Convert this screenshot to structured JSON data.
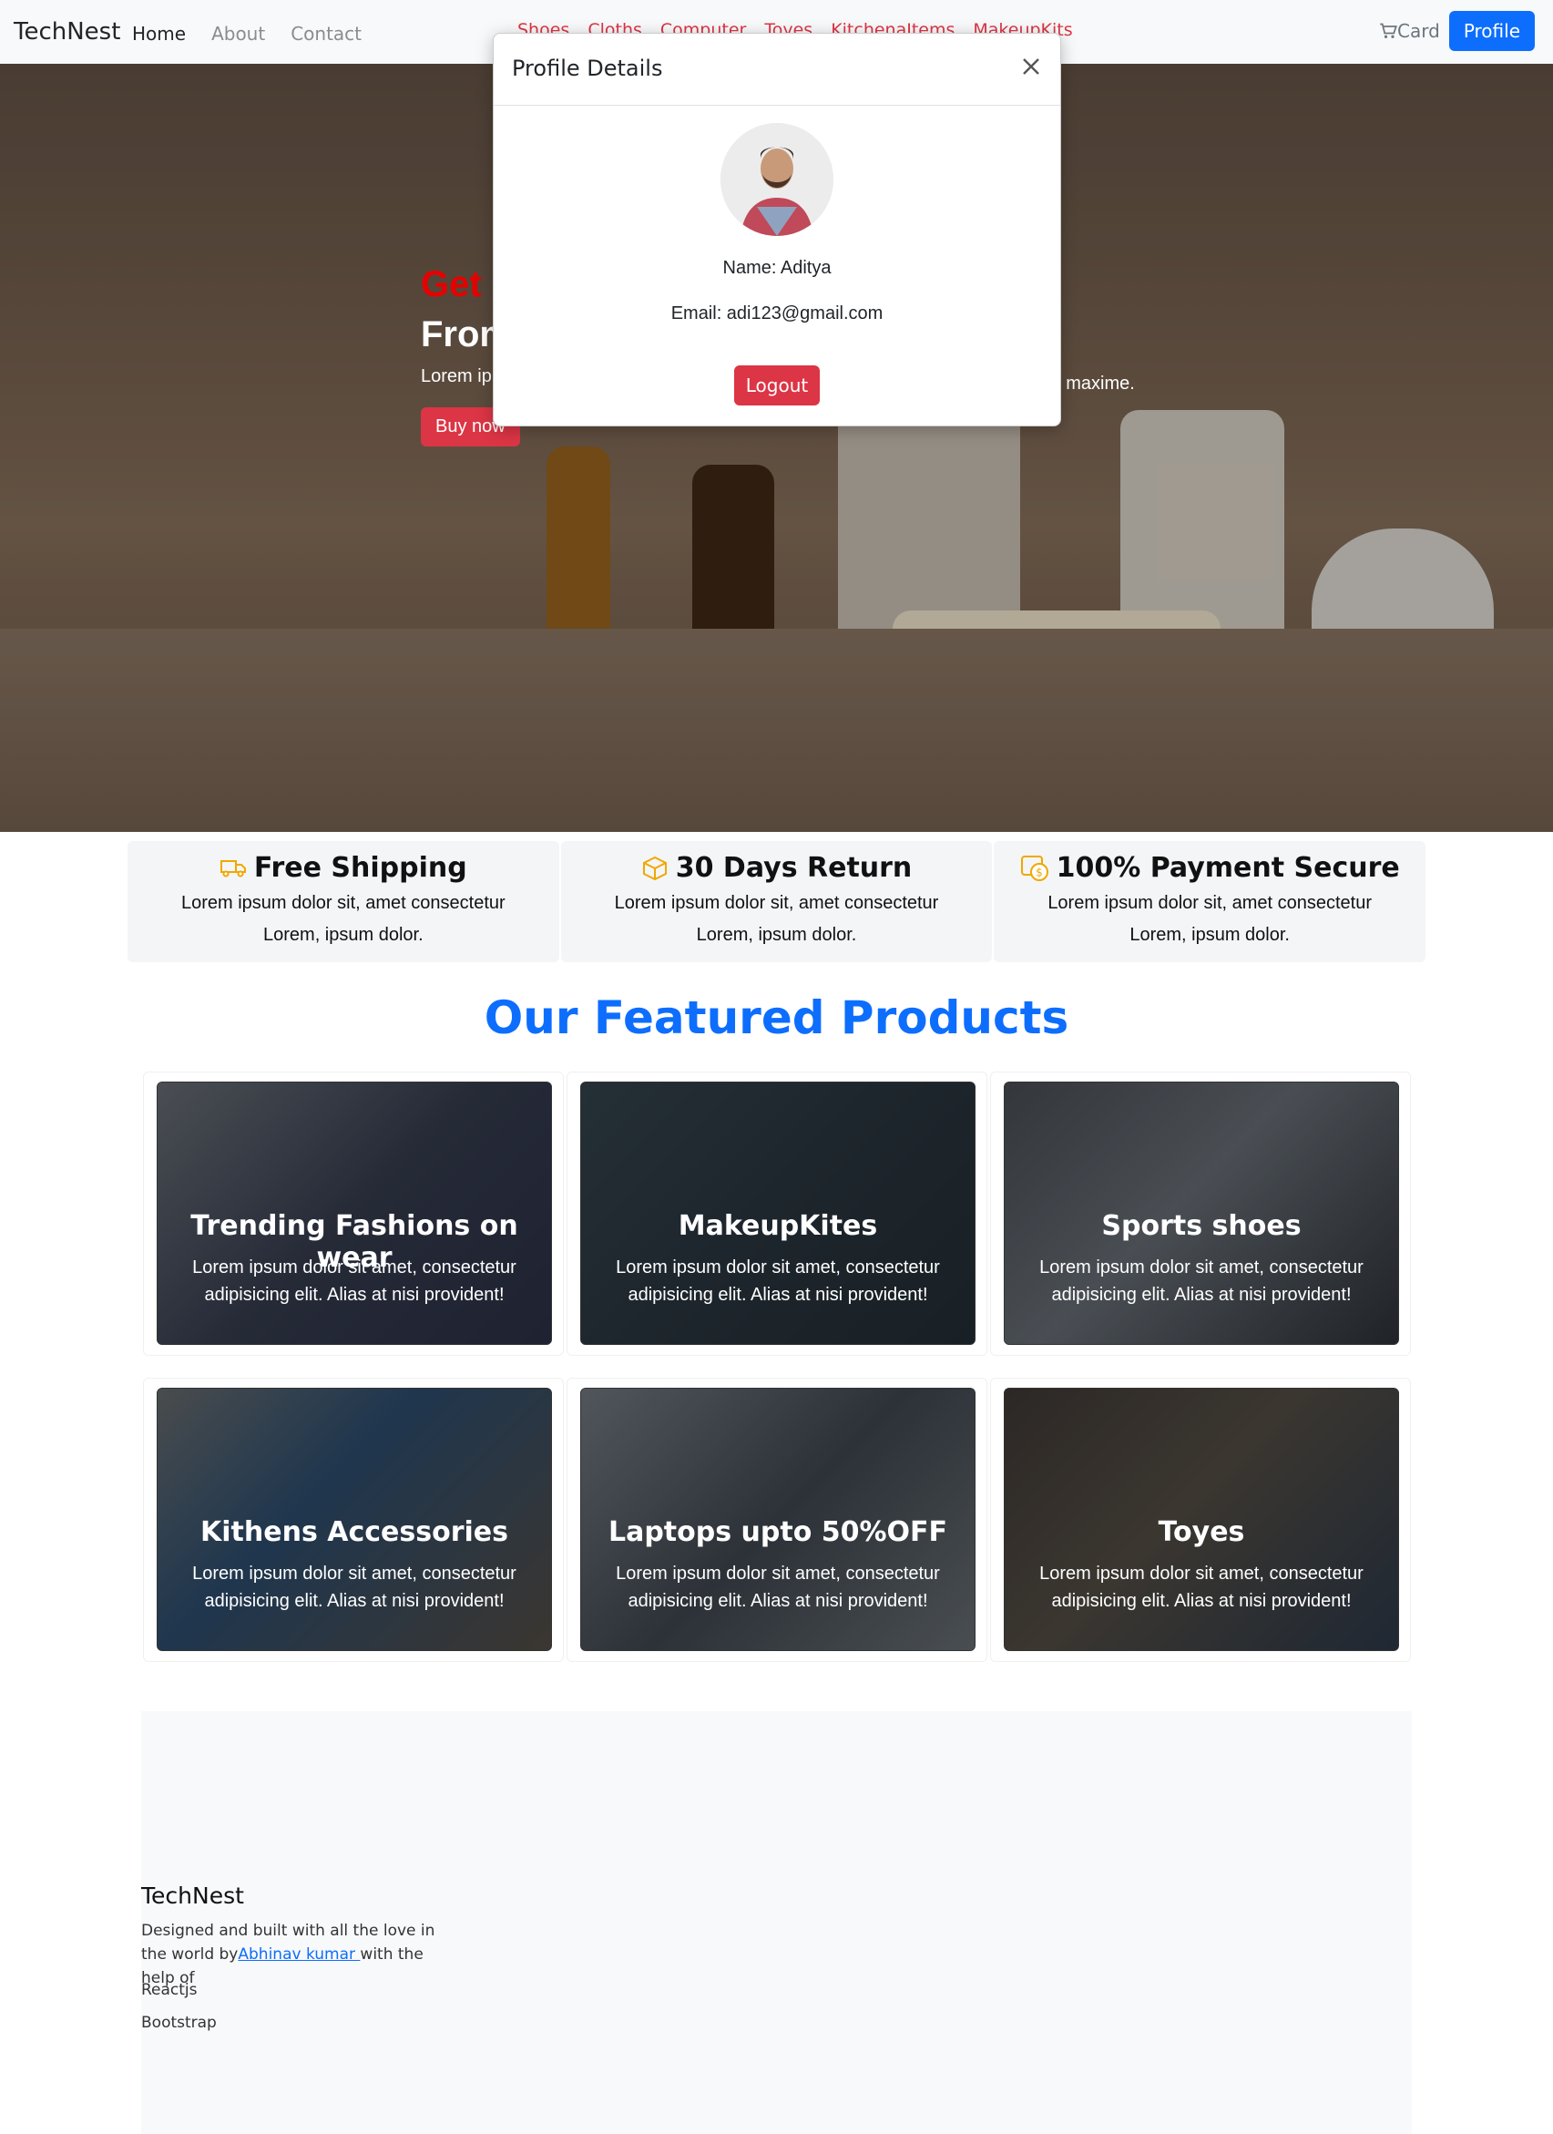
{
  "navbar": {
    "brand": "TechNest",
    "links": [
      "Home",
      "About",
      "Contact"
    ],
    "categories": [
      "Shoes",
      "Cloths",
      "Computer",
      "Toyes",
      "KitchenaItems",
      "MakeupKits"
    ],
    "cart_label": "Card",
    "profile_label": "Profile",
    "cart_icon": "cart-icon"
  },
  "hero": {
    "heading_accent": "Get",
    "heading_line2": "From",
    "lorem_start": "Lorem ip",
    "lorem_end": "m maxime.",
    "buy_label": "Buy now"
  },
  "modal": {
    "title": "Profile Details",
    "name_line": "Name: Aditya",
    "email_line": "Email: adi123@gmail.com",
    "logout_label": "Logout"
  },
  "features": [
    {
      "title": "Free Shipping",
      "desc": "Lorem ipsum dolor sit, amet consectetur Lorem, ipsum dolor.",
      "icon": "truck-icon"
    },
    {
      "title": "30 Days Return",
      "desc": "Lorem ipsum dolor sit, amet consectetur Lorem, ipsum dolor.",
      "icon": "box-icon"
    },
    {
      "title": "100% Payment Secure",
      "desc": "Lorem ipsum dolor sit, amet consectetur Lorem, ipsum dolor.",
      "icon": "coin-icon"
    }
  ],
  "featured_title": "Our Featured Products",
  "cards": [
    {
      "title": "Trending Fashions on wear",
      "text": "Lorem ipsum dolor sit amet, consectetur adipisicing elit. Alias at nisi provident!"
    },
    {
      "title": "MakeupKites",
      "text": "Lorem ipsum dolor sit amet, consectetur adipisicing elit. Alias at nisi provident!"
    },
    {
      "title": "Sports shoes",
      "text": "Lorem ipsum dolor sit amet, consectetur adipisicing elit. Alias at nisi provident!"
    },
    {
      "title": "Kithens Accessories",
      "text": "Lorem ipsum dolor sit amet, consectetur adipisicing elit. Alias at nisi provident!"
    },
    {
      "title": "Laptops upto 50%OFF",
      "text": "Lorem ipsum dolor sit amet, consectetur adipisicing elit. Alias at nisi provident!"
    },
    {
      "title": "Toyes",
      "text": "Lorem ipsum dolor sit amet, consectetur adipisicing elit. Alias at nisi provident!"
    }
  ],
  "footer": {
    "brand": "TechNest",
    "desc_before": "Designed and built with all the love in the world by",
    "author_link": "Abhinav kumar ",
    "desc_after": "with the help of",
    "tech1": "Reactjs",
    "tech2": "Bootstrap"
  },
  "colors": {
    "primary": "#0d6efd",
    "danger": "#dc3545",
    "accent_red": "#e60000"
  }
}
